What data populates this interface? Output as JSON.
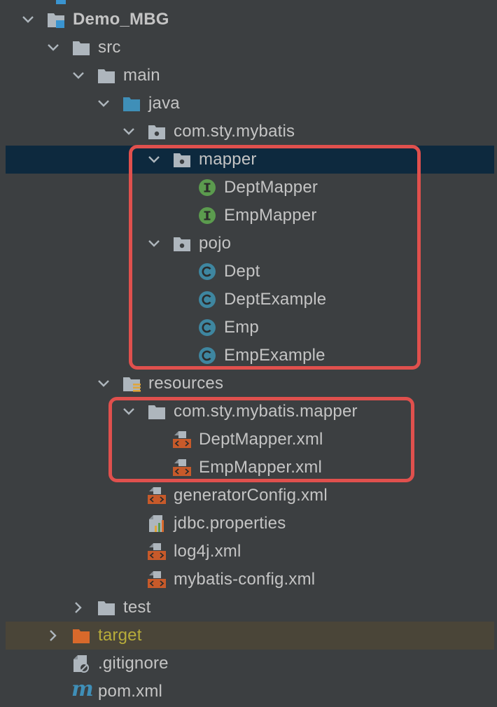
{
  "project_tree": {
    "items": [
      {
        "label": "Demo_MBG",
        "icon": "project-folder-icon",
        "arrow": "expanded"
      },
      {
        "label": "src",
        "icon": "folder-icon",
        "arrow": "expanded"
      },
      {
        "label": "main",
        "icon": "folder-icon",
        "arrow": "expanded"
      },
      {
        "label": "java",
        "icon": "source-folder-icon",
        "arrow": "expanded"
      },
      {
        "label": "com.sty.mybatis",
        "icon": "package-icon",
        "arrow": "expanded"
      },
      {
        "label": "mapper",
        "icon": "package-icon",
        "arrow": "expanded",
        "selected": true
      },
      {
        "label": "DeptMapper",
        "icon": "interface-icon"
      },
      {
        "label": "EmpMapper",
        "icon": "interface-icon"
      },
      {
        "label": "pojo",
        "icon": "package-icon",
        "arrow": "expanded"
      },
      {
        "label": "Dept",
        "icon": "class-icon"
      },
      {
        "label": "DeptExample",
        "icon": "class-icon"
      },
      {
        "label": "Emp",
        "icon": "class-icon"
      },
      {
        "label": "EmpExample",
        "icon": "class-icon"
      },
      {
        "label": "resources",
        "icon": "resources-folder-icon",
        "arrow": "expanded"
      },
      {
        "label": "com.sty.mybatis.mapper",
        "icon": "folder-icon",
        "arrow": "expanded"
      },
      {
        "label": "DeptMapper.xml",
        "icon": "xml-file-icon"
      },
      {
        "label": "EmpMapper.xml",
        "icon": "xml-file-icon"
      },
      {
        "label": "generatorConfig.xml",
        "icon": "xml-file-icon"
      },
      {
        "label": "jdbc.properties",
        "icon": "properties-file-icon"
      },
      {
        "label": "log4j.xml",
        "icon": "xml-file-icon"
      },
      {
        "label": "mybatis-config.xml",
        "icon": "xml-file-icon"
      },
      {
        "label": "test",
        "icon": "folder-icon",
        "arrow": "collapsed"
      },
      {
        "label": "target",
        "icon": "excluded-folder-icon",
        "arrow": "collapsed",
        "excluded": true
      },
      {
        "label": ".gitignore",
        "icon": "ignored-file-icon"
      },
      {
        "label": "pom.xml",
        "icon": "maven-icon"
      }
    ]
  },
  "colors": {
    "background": "#3c3f41",
    "selection": "#0d293e",
    "excluded_row": "#4a4538",
    "highlight_box": "#e0504d",
    "interface_icon": "#5b9b4e",
    "class_icon": "#3e86a0",
    "xml_icon": "#c75a2a",
    "target_text": "#b7ac3a"
  }
}
